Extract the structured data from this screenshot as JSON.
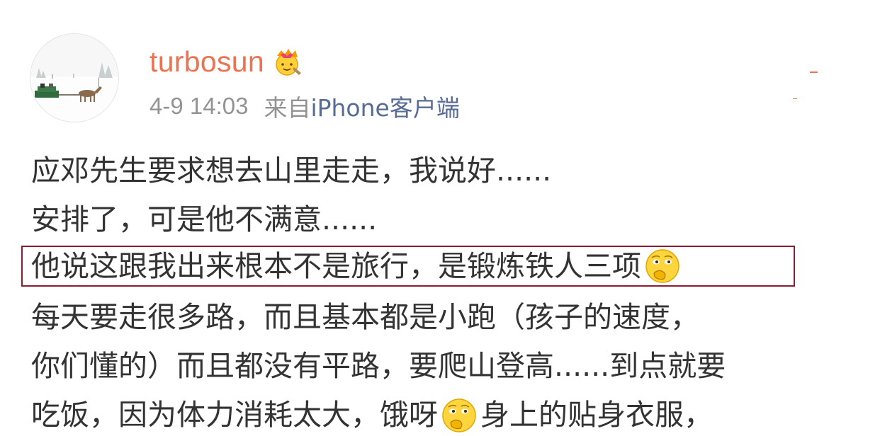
{
  "user": {
    "name": "turbosun",
    "badge_icon": "crown-icon"
  },
  "meta": {
    "time": "4-9 14:03",
    "from": "来自",
    "source": "iPhone客户端"
  },
  "post": {
    "lines": [
      "应邓先生要求想去山里走走，我说好......",
      "安排了，可是他不满意......",
      "他说这跟我出来根本不是旅行，是锻炼铁人三项",
      "每天要走很多路，而且基本都是小跑（孩子的速度，",
      "你们懂的）而且都没有平路，要爬山登高......到点就要",
      "吃饭，因为体力消耗太大，饿呀",
      "身上的贴身衣服，"
    ],
    "emoji_icon": "thinking-face-icon"
  },
  "colors": {
    "username": "#eb7350",
    "meta": "#939393",
    "source": "#576b95",
    "text": "#333333",
    "highlight_border": "#8c1e34"
  }
}
